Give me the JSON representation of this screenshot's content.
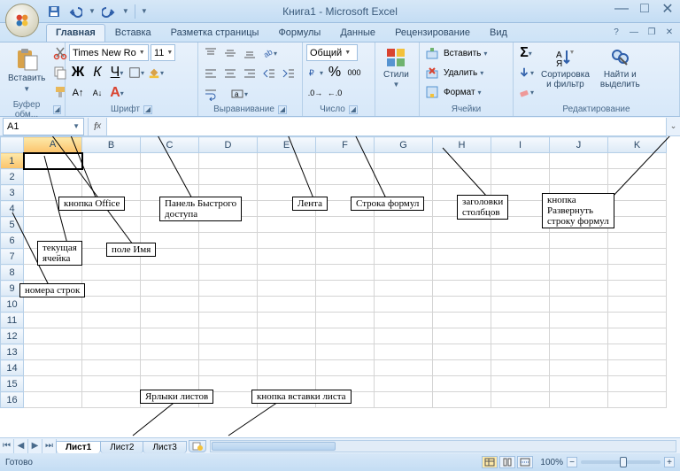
{
  "title": "Книга1 - Microsoft Excel",
  "tabs": [
    "Главная",
    "Вставка",
    "Разметка страницы",
    "Формулы",
    "Данные",
    "Рецензирование",
    "Вид"
  ],
  "active_tab": 0,
  "ribbon": {
    "clipboard": {
      "paste": "Вставить",
      "label": "Буфер обм..."
    },
    "font": {
      "name": "Times New Ro",
      "size": "11",
      "label": "Шрифт"
    },
    "alignment": {
      "label": "Выравнивание"
    },
    "number": {
      "format": "Общий",
      "label": "Число"
    },
    "styles": {
      "styles_btn": "Стили",
      "label": ""
    },
    "cells": {
      "insert": "Вставить",
      "delete": "Удалить",
      "format": "Формат",
      "label": "Ячейки"
    },
    "editing": {
      "sort": "Сортировка\nи фильтр",
      "find": "Найти и\nвыделить",
      "label": "Редактирование"
    }
  },
  "name_box": "A1",
  "formula": "",
  "columns": [
    "A",
    "B",
    "C",
    "D",
    "E",
    "F",
    "G",
    "H",
    "I",
    "J",
    "K"
  ],
  "rows": 16,
  "active_cell": {
    "row": 1,
    "col": 0
  },
  "sheets": [
    "Лист1",
    "Лист2",
    "Лист3"
  ],
  "active_sheet": 0,
  "status": "Готово",
  "zoom": "100%",
  "annotations": {
    "office": "кнопка Office",
    "qat": "Панель Быстрого\nдоступа",
    "ribbon": "Лента",
    "formula_bar": "Строка формул",
    "col_headers": "заголовки\nстолбцов",
    "expand": "кнопка\nРазвернуть\nстроку формул",
    "active_cell": "текущая\nячейка",
    "name_box": "поле Имя",
    "row_nums": "номера строк",
    "sheet_tabs": "Ярлыки листов",
    "new_sheet": "кнопка вставки листа"
  }
}
